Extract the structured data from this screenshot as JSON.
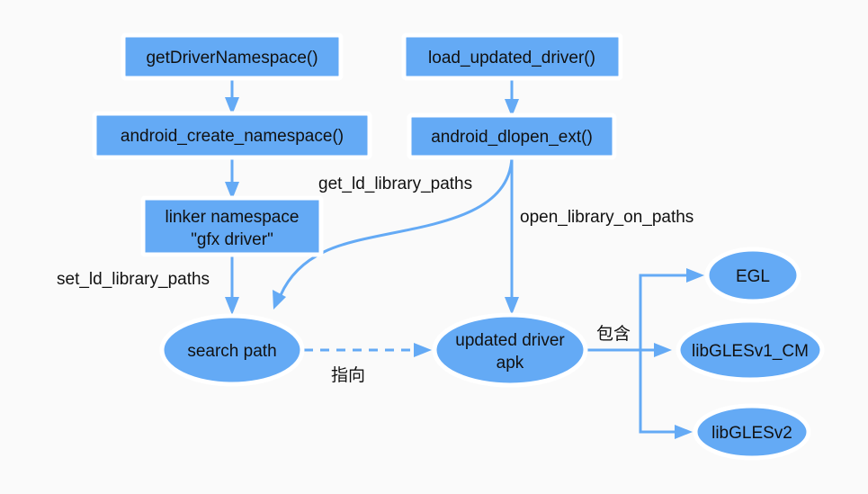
{
  "colors": {
    "node": "#64aaf5",
    "edge": "#64aaf5",
    "background": "#fafafa"
  },
  "nodes": {
    "get_driver_namespace": "getDriverNamespace()",
    "android_create_namespace": "android_create_namespace()",
    "linker_namespace_line1": "linker namespace",
    "linker_namespace_line2": "\"gfx driver\"",
    "load_updated_driver": "load_updated_driver()",
    "android_dlopen_ext": "android_dlopen_ext()",
    "search_path": "search path",
    "updated_driver_line1": "updated driver",
    "updated_driver_line2": "apk",
    "egl": "EGL",
    "gles_v1": "libGLESv1_CM",
    "gles_v2": "libGLESv2"
  },
  "edge_labels": {
    "get_ld_library_paths": "get_ld_library_paths",
    "open_library_on_paths": "open_library_on_paths",
    "set_ld_library_paths": "set_ld_library_paths",
    "points_to": "指向",
    "contains": "包含"
  }
}
